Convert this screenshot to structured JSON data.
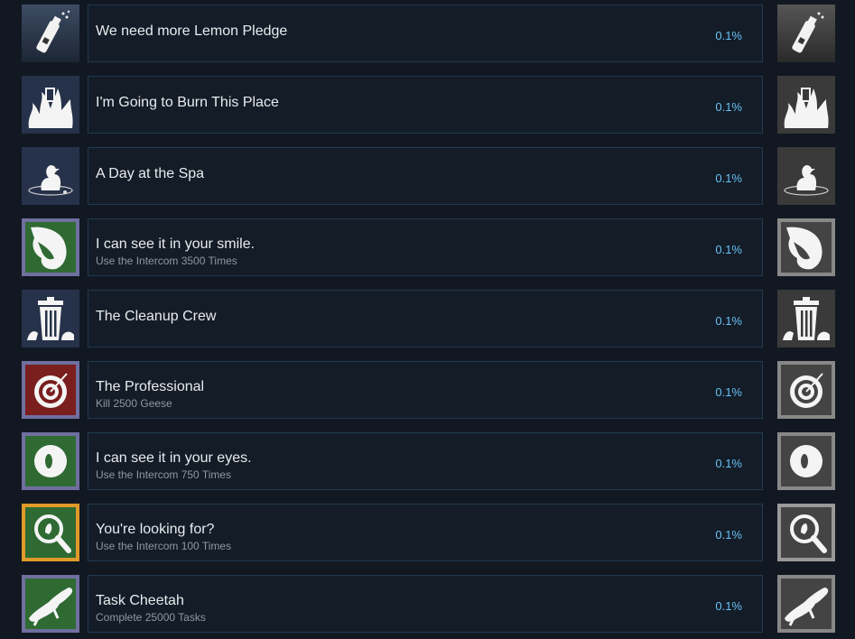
{
  "achievements": [
    {
      "title": "We need more Lemon Pledge",
      "desc": "",
      "percent": "0.1%",
      "icon": "spray-can-icon",
      "bg": "#2c3a50"
    },
    {
      "title": "I'm Going to Burn This Place",
      "desc": "",
      "percent": "0.1%",
      "icon": "fire-icon",
      "bg": "#2c3a50"
    },
    {
      "title": "A Day at the Spa",
      "desc": "",
      "percent": "0.1%",
      "icon": "duck-bath-icon",
      "bg": "#2c3a50"
    },
    {
      "title": "I can see it in your smile.",
      "desc": "Use the Intercom 3500 Times",
      "percent": "0.1%",
      "icon": "goose-beak-icon",
      "bg": "#2f6a33"
    },
    {
      "title": "The Cleanup Crew",
      "desc": "",
      "percent": "0.1%",
      "icon": "trash-can-icon",
      "bg": "#2c3a50"
    },
    {
      "title": "The Professional",
      "desc": "Kill 2500 Geese",
      "percent": "0.1%",
      "icon": "target-icon",
      "bg": "#7a1e1e"
    },
    {
      "title": "I can see it in your eyes.",
      "desc": "Use the Intercom 750 Times",
      "percent": "0.1%",
      "icon": "eye-icon",
      "bg": "#2f6a33"
    },
    {
      "title": "You're looking for?",
      "desc": "Use the Intercom 100 Times",
      "percent": "0.1%",
      "icon": "magnifier-icon",
      "bg": "#2f6a33"
    },
    {
      "title": "Task Cheetah",
      "desc": "Complete 25000 Tasks",
      "percent": "0.1%",
      "icon": "cheetah-icon",
      "bg": "#2f6a33"
    }
  ]
}
